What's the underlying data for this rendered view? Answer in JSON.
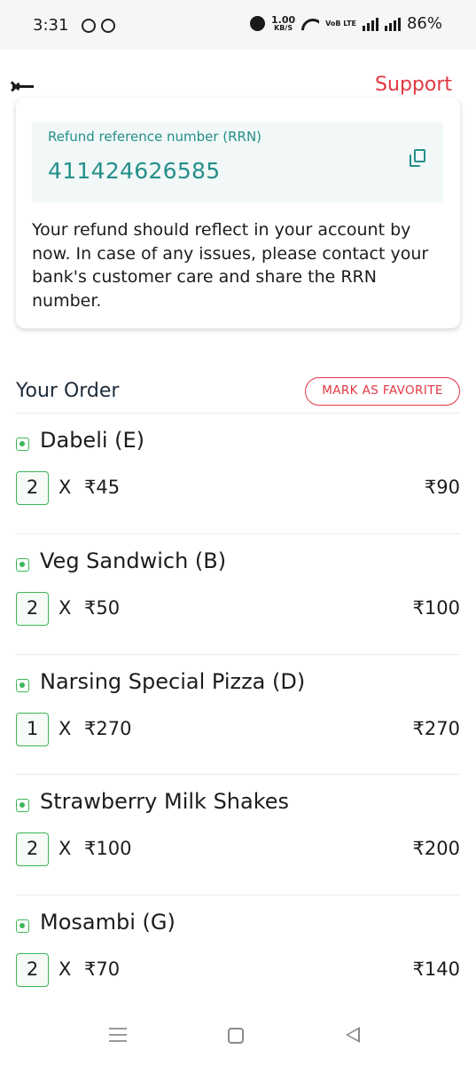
{
  "status_bar": {
    "time": "3:31",
    "speed_value": "1.00",
    "speed_unit": "KB/S",
    "network_label": "VoB LTE",
    "battery": "86%"
  },
  "header": {
    "support_label": "Support"
  },
  "refund": {
    "rrn_label": "Refund reference number (RRN)",
    "rrn_value": "411424626585",
    "message": "Your refund should reflect in your account by now. In case of any issues, please contact your bank's customer care and share the RRN number."
  },
  "order": {
    "title": "Your Order",
    "favorite_label": "MARK AS FAVORITE",
    "items": [
      {
        "name": "Dabeli (E)",
        "qty": "2",
        "x": "X",
        "price": "₹45",
        "total": "₹90"
      },
      {
        "name": "Veg Sandwich (B)",
        "qty": "2",
        "x": "X",
        "price": "₹50",
        "total": "₹100"
      },
      {
        "name": "Narsing Special Pizza (D)",
        "qty": "1",
        "x": "X",
        "price": "₹270",
        "total": "₹270"
      },
      {
        "name": "Strawberry Milk Shakes",
        "qty": "2",
        "x": "X",
        "price": "₹100",
        "total": "₹200"
      },
      {
        "name": "Mosambi (G)",
        "qty": "2",
        "x": "X",
        "price": "₹70",
        "total": "₹140"
      }
    ]
  },
  "colors": {
    "accent": "#e23744",
    "teal": "#258f8a",
    "veg_green": "#3ab757"
  },
  "icons": {
    "back": "arrow-left-icon",
    "copy": "copy-icon",
    "veg": "veg-indicator-icon"
  }
}
